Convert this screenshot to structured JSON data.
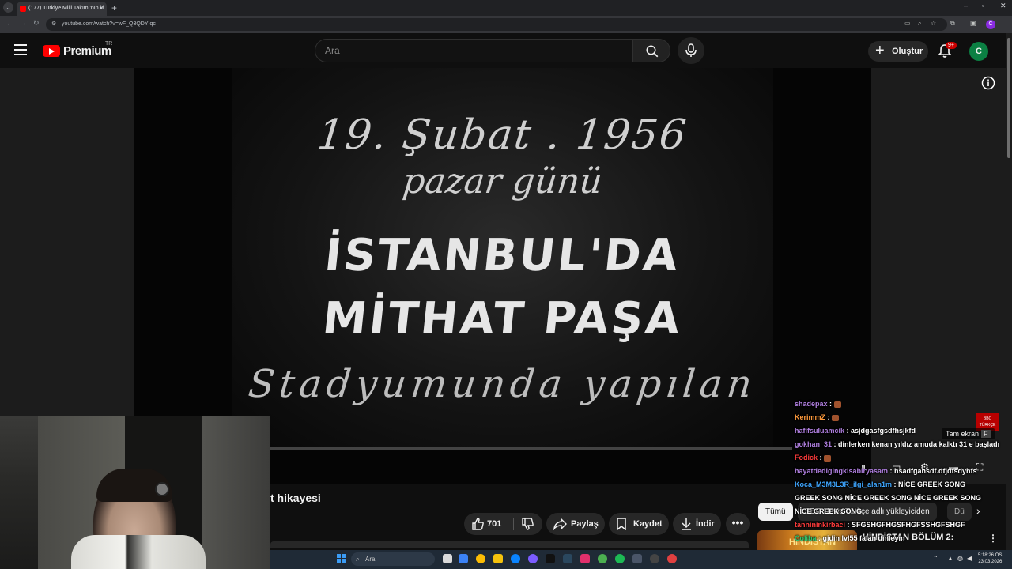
{
  "browser": {
    "tab_title": "(177) Türkiye Milli Takımı'nın ki",
    "tab_close": "×",
    "new_tab": "+",
    "tab_menu": "⌄",
    "url": "youtube.com/watch?v=wF_Q3QDYIqc",
    "window_controls": [
      "–",
      "▫",
      "✕"
    ]
  },
  "header": {
    "logo_text": "Premium",
    "logo_region": "TR",
    "search_placeholder": "Ara",
    "create_label": "Oluştur",
    "notification_count": "9+",
    "avatar_initial": "C"
  },
  "video": {
    "film_lines": [
      "19. Şubat . 1956",
      "pazar günü",
      "İSTANBUL'DA",
      "MİTHAT PAŞA",
      "Stadyumunda yapılan"
    ],
    "fullscreen_tooltip": "Tam ekran",
    "fullscreen_key": "F",
    "bbc_badge": "BBC TÜRKÇE",
    "progress": 0.0
  },
  "info": {
    "title": "t hikayesi",
    "like_count": "701",
    "share_label": "Paylaş",
    "save_label": "Kaydet",
    "download_label": "İndir",
    "more_label": "•••"
  },
  "chat": [
    {
      "user": "shadepax",
      "color": "#b07fe0",
      "text": ""
    },
    {
      "user": "KerimmZ",
      "color": "#ff9a3c",
      "text": ""
    },
    {
      "user": "hafifsuluamcik",
      "color": "#b07fe0",
      "text": ": asjdgasfgsdfhsjkfd"
    },
    {
      "user": "gokhan_31",
      "color": "#b07fe0",
      "text": ": dinlerken kenan yıldız amuda kalktı 31 e başladı"
    },
    {
      "user": "Fodick",
      "color": "#ff3b3b",
      "text": ""
    },
    {
      "user": "hayatdedigingkisabiryasam",
      "color": "#b07fe0",
      "text": ": hsadfgahsdf.dfjdfsdyhfs"
    },
    {
      "user": "Koca_M3M3L3R_ilgi_alan1m",
      "color": "#3ea6ff",
      "text": ": NİCE GREEK SONG"
    },
    {
      "user": "",
      "color": "#ffffff",
      "text": "GREEK SONG  NİCE GREEK SONG  NİCE GREEK SONG"
    },
    {
      "user": "",
      "color": "#ffffff",
      "text": "NİCE GREEK SONG"
    },
    {
      "user": "tannininkirbaci",
      "color": "#ff3b3b",
      "text": ": SFGSHGFHGSFHGFSSHGFSHGF"
    },
    {
      "user": "Coliba",
      "color": "#2ecc71",
      "text": ": gidin lvl55 falan dinleyin"
    }
  ],
  "related": {
    "chips": [
      "Tümü",
      "BBC News Türkçe adlı yükleyiciden",
      "Dü"
    ],
    "next_icon": "›",
    "thumb_label": "HİNDİSTAN",
    "first_title": "HİNDİSTAN BÖLÜM 2:",
    "more_icon": "⋮"
  },
  "taskbar": {
    "search_placeholder": "Ara",
    "time": "5:18:26 ÖS",
    "date": "23.03.2026"
  },
  "icons": {
    "menu": "menu-icon",
    "search": "search-icon",
    "mic": "mic-icon",
    "bell": "bell-icon",
    "info": "info-icon"
  },
  "colors": {
    "youtube_red": "#ff0000",
    "background": "#0f0f0f",
    "avatar": "#0b8043"
  }
}
